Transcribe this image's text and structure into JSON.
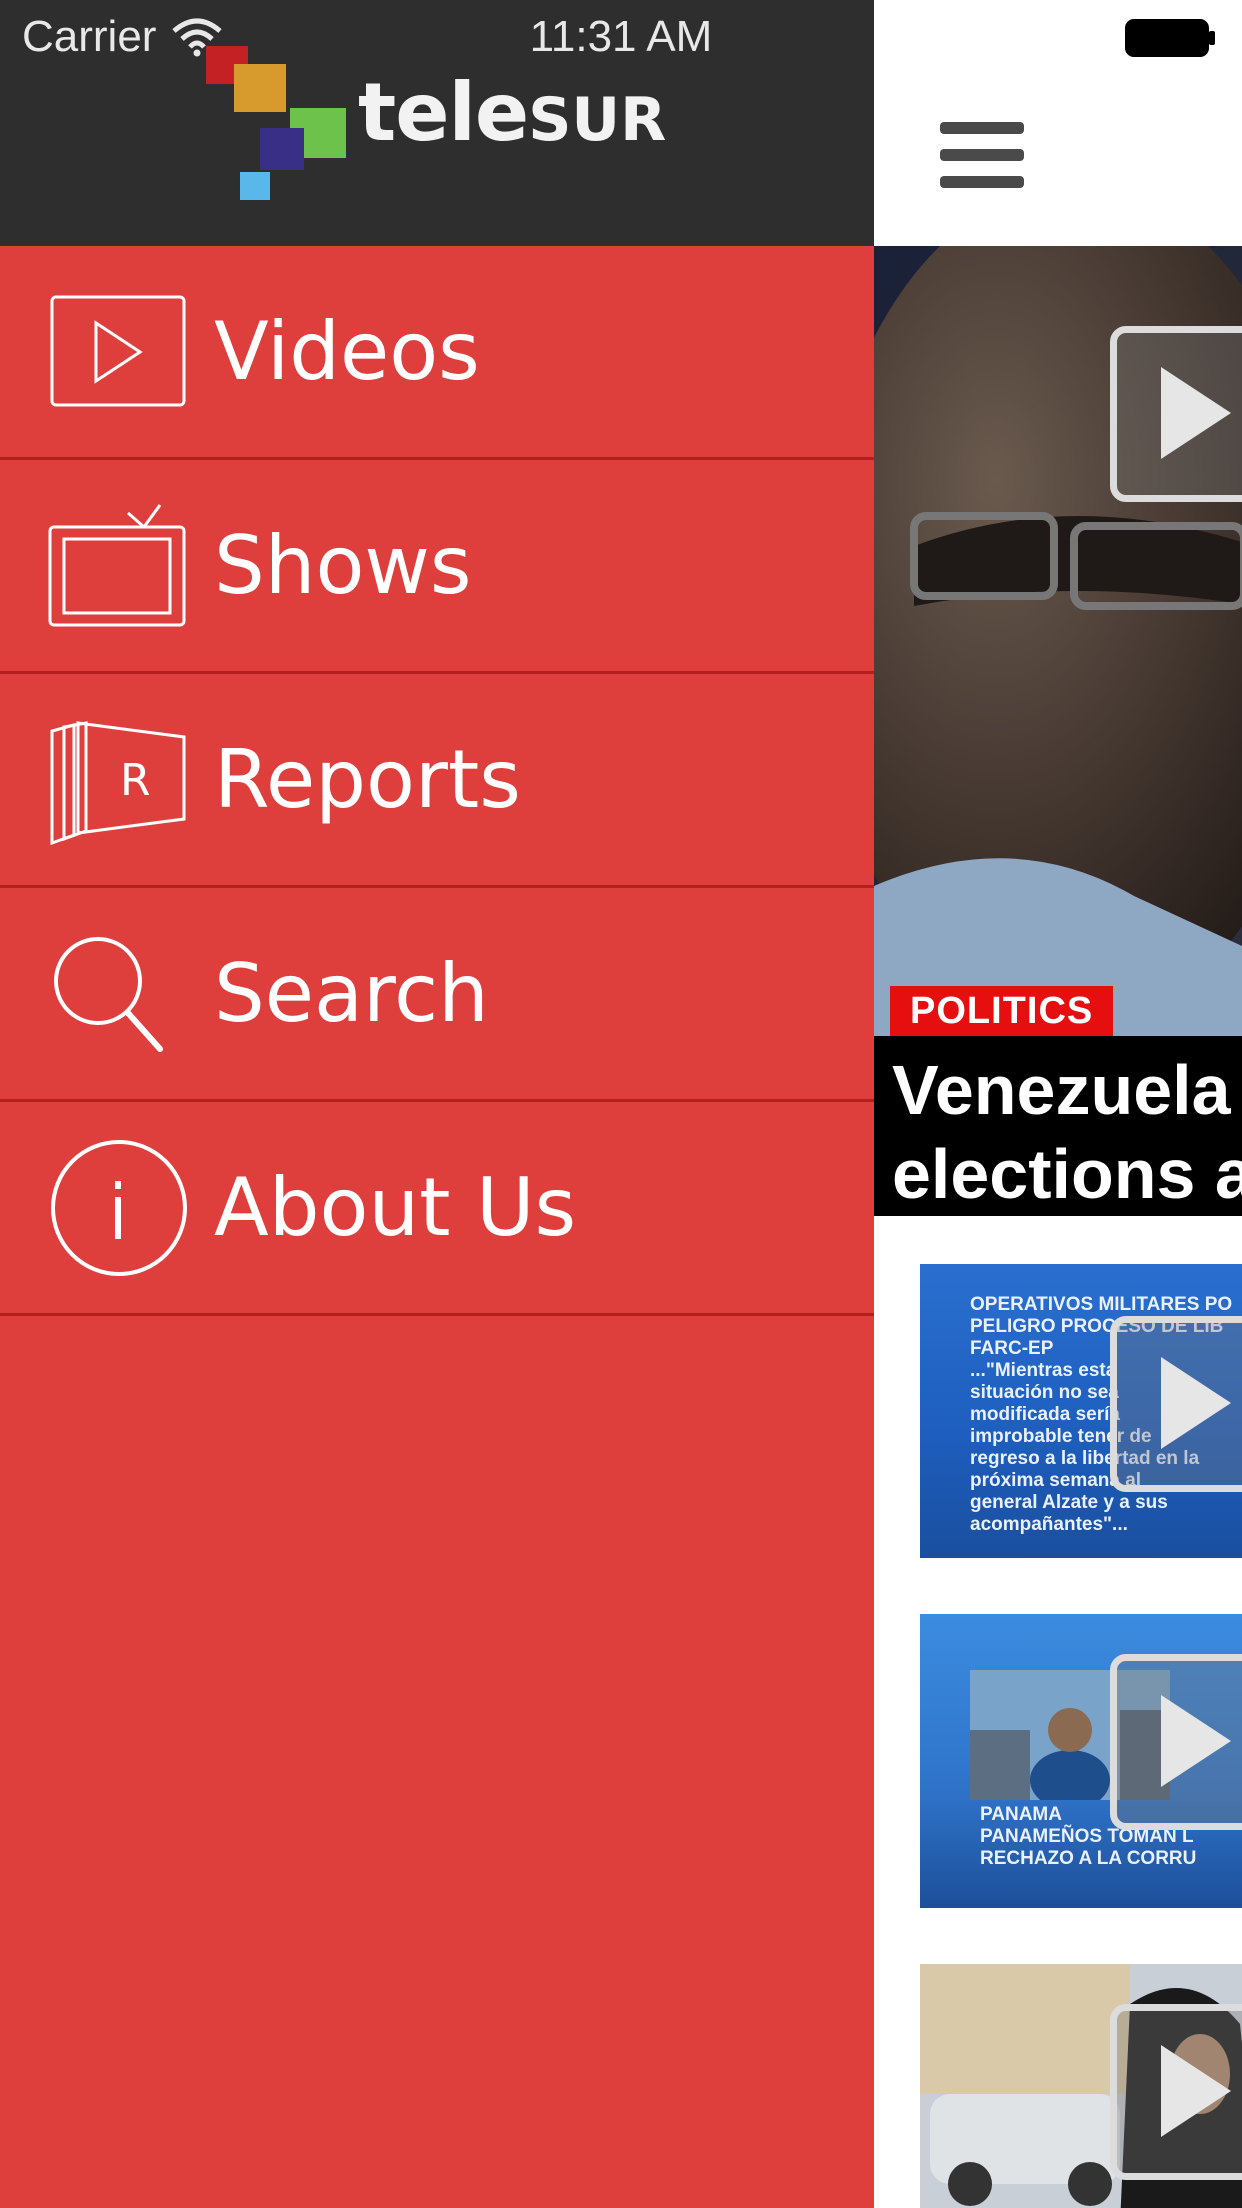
{
  "status_bar": {
    "carrier": "Carrier",
    "time": "11:31 AM"
  },
  "brand": {
    "logo_text_tele": "tele",
    "logo_text_sur": "SUR"
  },
  "drawer": {
    "background_color": "#de3f3c",
    "header_color": "#2e2e2e",
    "items": [
      {
        "label": "Videos",
        "icon": "play-icon"
      },
      {
        "label": "Shows",
        "icon": "tv-icon"
      },
      {
        "label": "Reports",
        "icon": "reports-icon"
      },
      {
        "label": "Search",
        "icon": "search-icon"
      },
      {
        "label": "About Us",
        "icon": "info-icon"
      }
    ]
  },
  "content": {
    "hero": {
      "category": "POLITICS",
      "title": "Venezuela\nelections a"
    },
    "thumbnails": [
      {
        "overlay_text": "OPERATIVOS MILITARES PO\nPELIGRO PROCESO DE LIB\nFARC-EP\n...\"Mientras esta\nsituación no sea\nmodificada sería\nimprobable tener de\nregreso a la libertad en la\npróxima semana al\ngeneral Alzate y a sus\nacompañantes\"..."
      },
      {
        "overlay_text": "PANAMA\nPANAMEÑOS TOMAN L\nRECHAZO A LA CORRU"
      },
      {
        "overlay_text": ""
      }
    ]
  }
}
